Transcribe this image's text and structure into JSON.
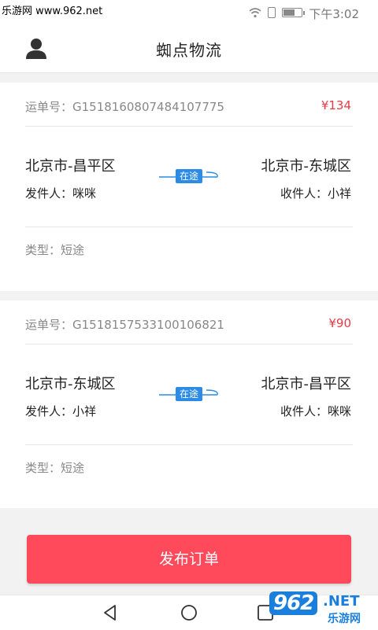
{
  "status_bar": {
    "watermark": "乐游网 www.962.net",
    "time": "下午3:02"
  },
  "header": {
    "title": "蜘点物流",
    "avatar_icon": "user-icon"
  },
  "orders": [
    {
      "waybill_label": "运单号：G1518160807484107775",
      "price": "¥134",
      "from_city": "北京市-昌平区",
      "to_city": "北京市-东城区",
      "sender": "发件人：咪咪",
      "receiver": "收件人：小祥",
      "status": "在途",
      "type": "类型：短途"
    },
    {
      "waybill_label": "运单号：G1518157533100106821",
      "price": "¥90",
      "from_city": "北京市-东城区",
      "to_city": "北京市-昌平区",
      "sender": "发件人：小祥",
      "receiver": "收件人：咪咪",
      "status": "在途",
      "type": "类型：短途"
    }
  ],
  "actions": {
    "publish_label": "发布订单"
  },
  "watermark_br": {
    "logo": "962",
    "net": ".NET",
    "sub": "乐游网"
  },
  "colors": {
    "accent_red": "#ff4a5c",
    "price_red": "#e83a45",
    "transit_blue": "#2b8be6"
  }
}
